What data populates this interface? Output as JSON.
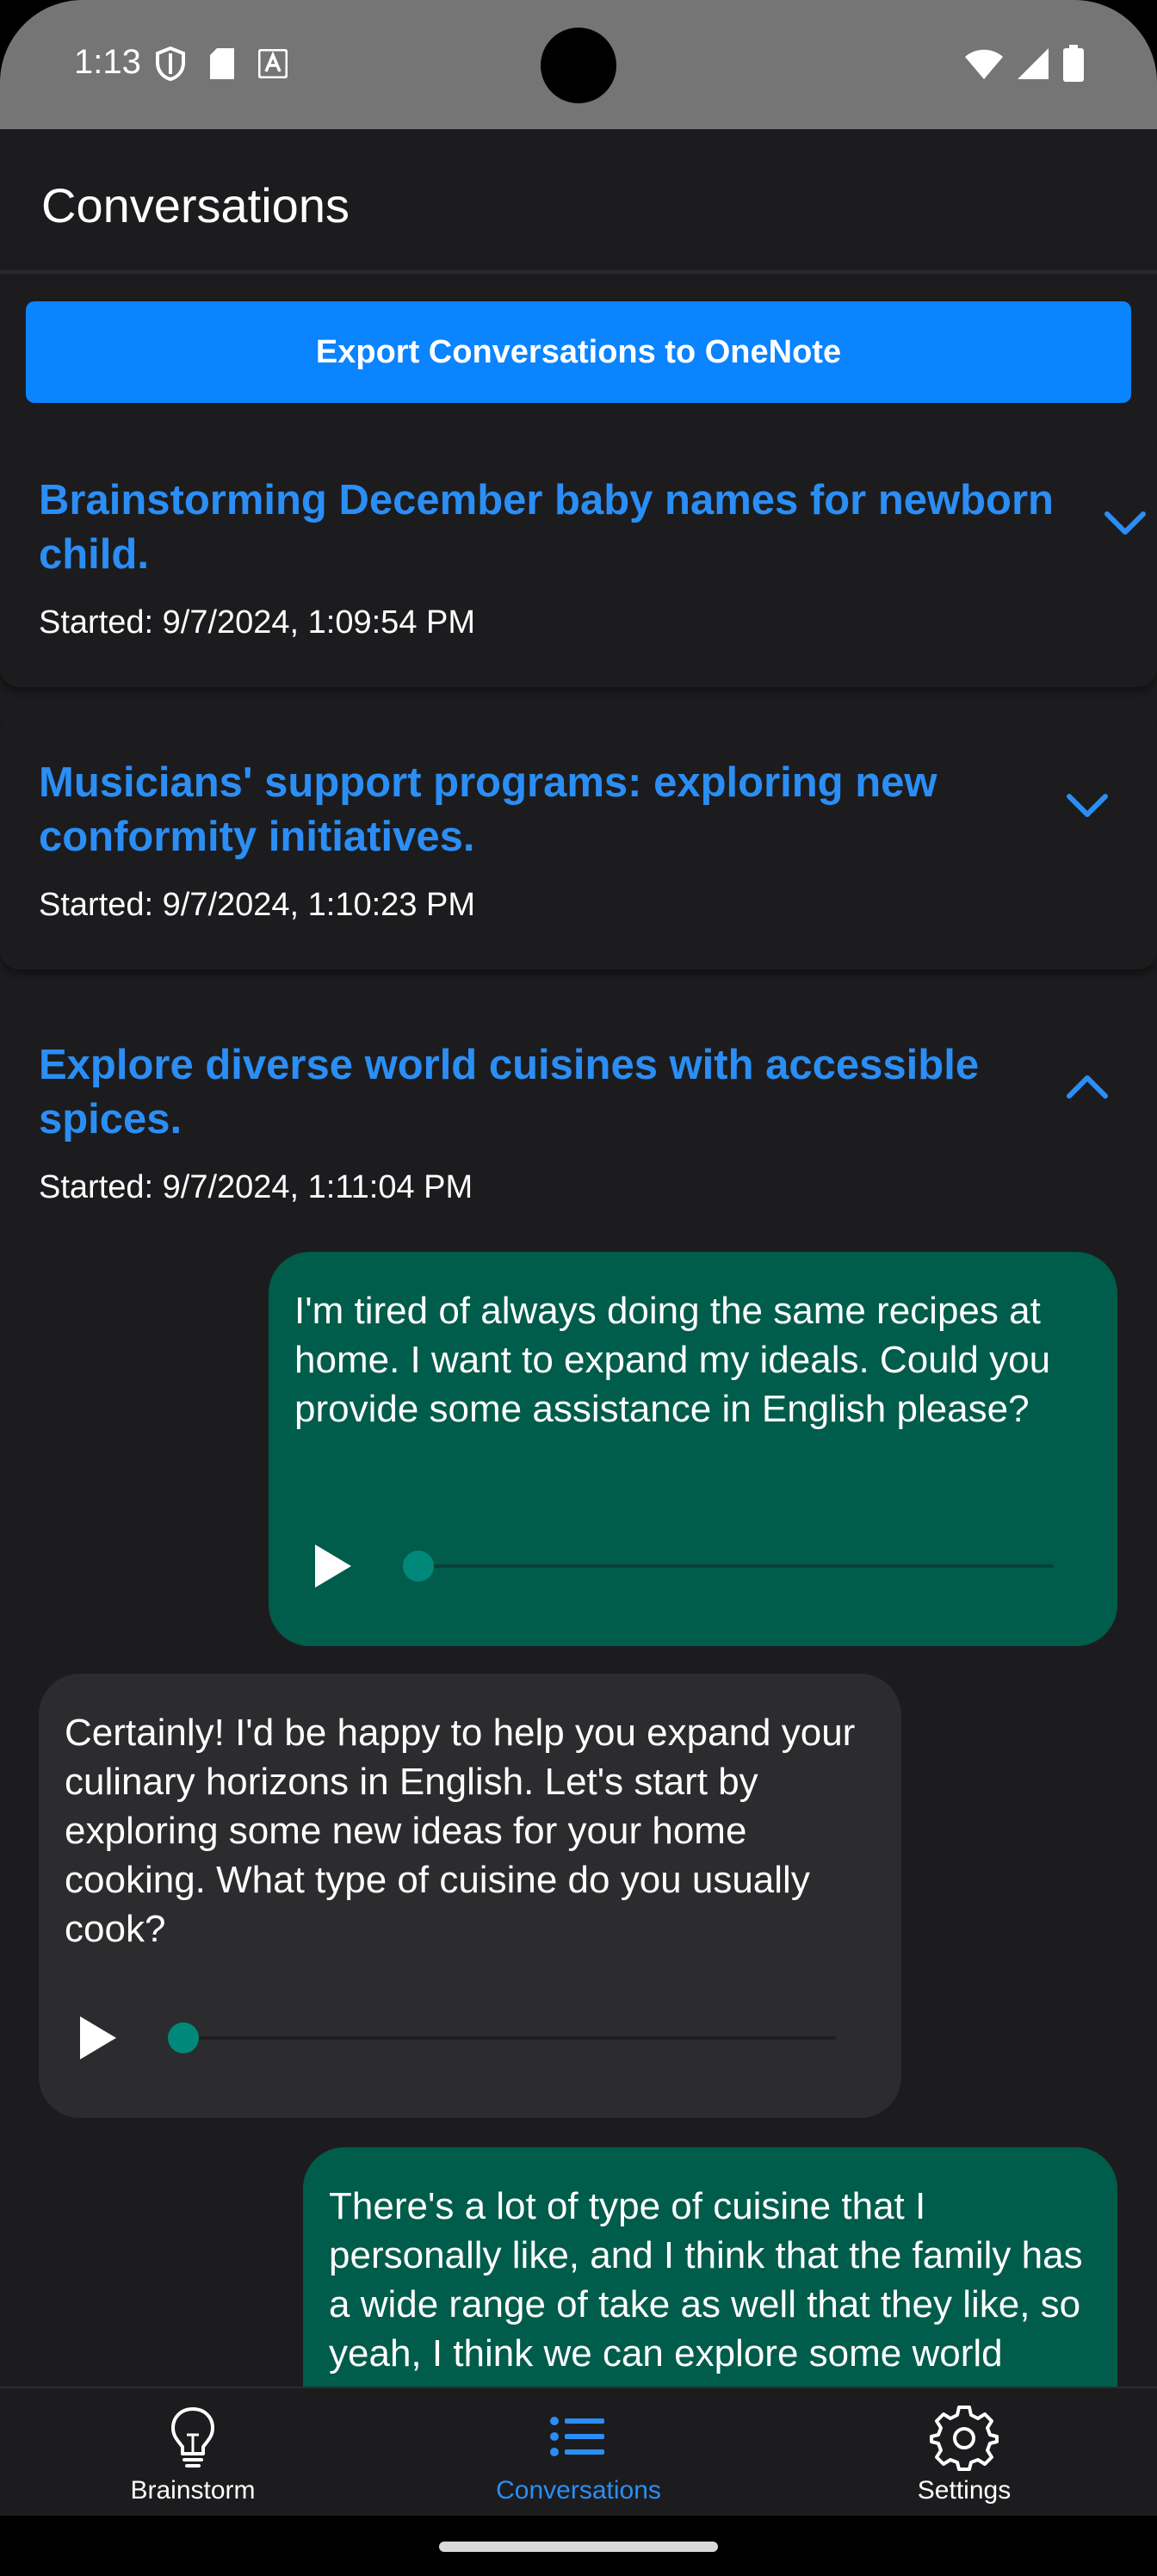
{
  "status_bar": {
    "time": "1:13",
    "icons_left": [
      "shield-icon",
      "sd-card-icon",
      "font-a-icon"
    ],
    "icons_right": [
      "wifi-icon",
      "cell-signal-icon",
      "battery-icon"
    ]
  },
  "app_bar": {
    "title": "Conversations"
  },
  "export_button": {
    "label": "Export Conversations to OneNote"
  },
  "conversations": [
    {
      "title": "Brainstorming December baby names for newborn child.",
      "started": "Started: 9/7/2024, 1:09:54 PM",
      "expanded": false
    },
    {
      "title": "Musicians' support programs: exploring new conformity initiatives.",
      "started": "Started: 9/7/2024, 1:10:23 PM",
      "expanded": false
    },
    {
      "title": "Explore diverse world cuisines with accessible spices.",
      "started": "Started: 9/7/2024, 1:11:04 PM",
      "expanded": true,
      "messages": [
        {
          "role": "user",
          "text": "I'm tired of always doing the same recipes at home. I want to expand my ideals. Could you provide some assistance in English please?",
          "audio_progress": 0
        },
        {
          "role": "assistant",
          "text": "Certainly! I'd be happy to help you expand your culinary horizons in English. Let's start by exploring some new ideas for your home cooking. What type of cuisine do you usually cook?",
          "audio_progress": 0
        },
        {
          "role": "user",
          "text": "There's a lot of type of cuisine that I personally like, and I think that the family has a wide range of take as well that they like, so yeah, I think we can explore some world cuisine with spices that I can find"
        }
      ]
    }
  ],
  "bottom_nav": {
    "items": [
      {
        "label": "Brainstorm",
        "icon": "lightbulb-icon",
        "active": false
      },
      {
        "label": "Conversations",
        "icon": "list-icon",
        "active": true
      },
      {
        "label": "Settings",
        "icon": "gear-icon",
        "active": false
      }
    ]
  },
  "colors": {
    "accent": "#2b8ef5",
    "button": "#0a84ff",
    "user_bubble": "#005c4b",
    "assistant_bubble": "#2c2c2e",
    "background": "#1c1c1e",
    "slider_thumb": "#00897b"
  }
}
